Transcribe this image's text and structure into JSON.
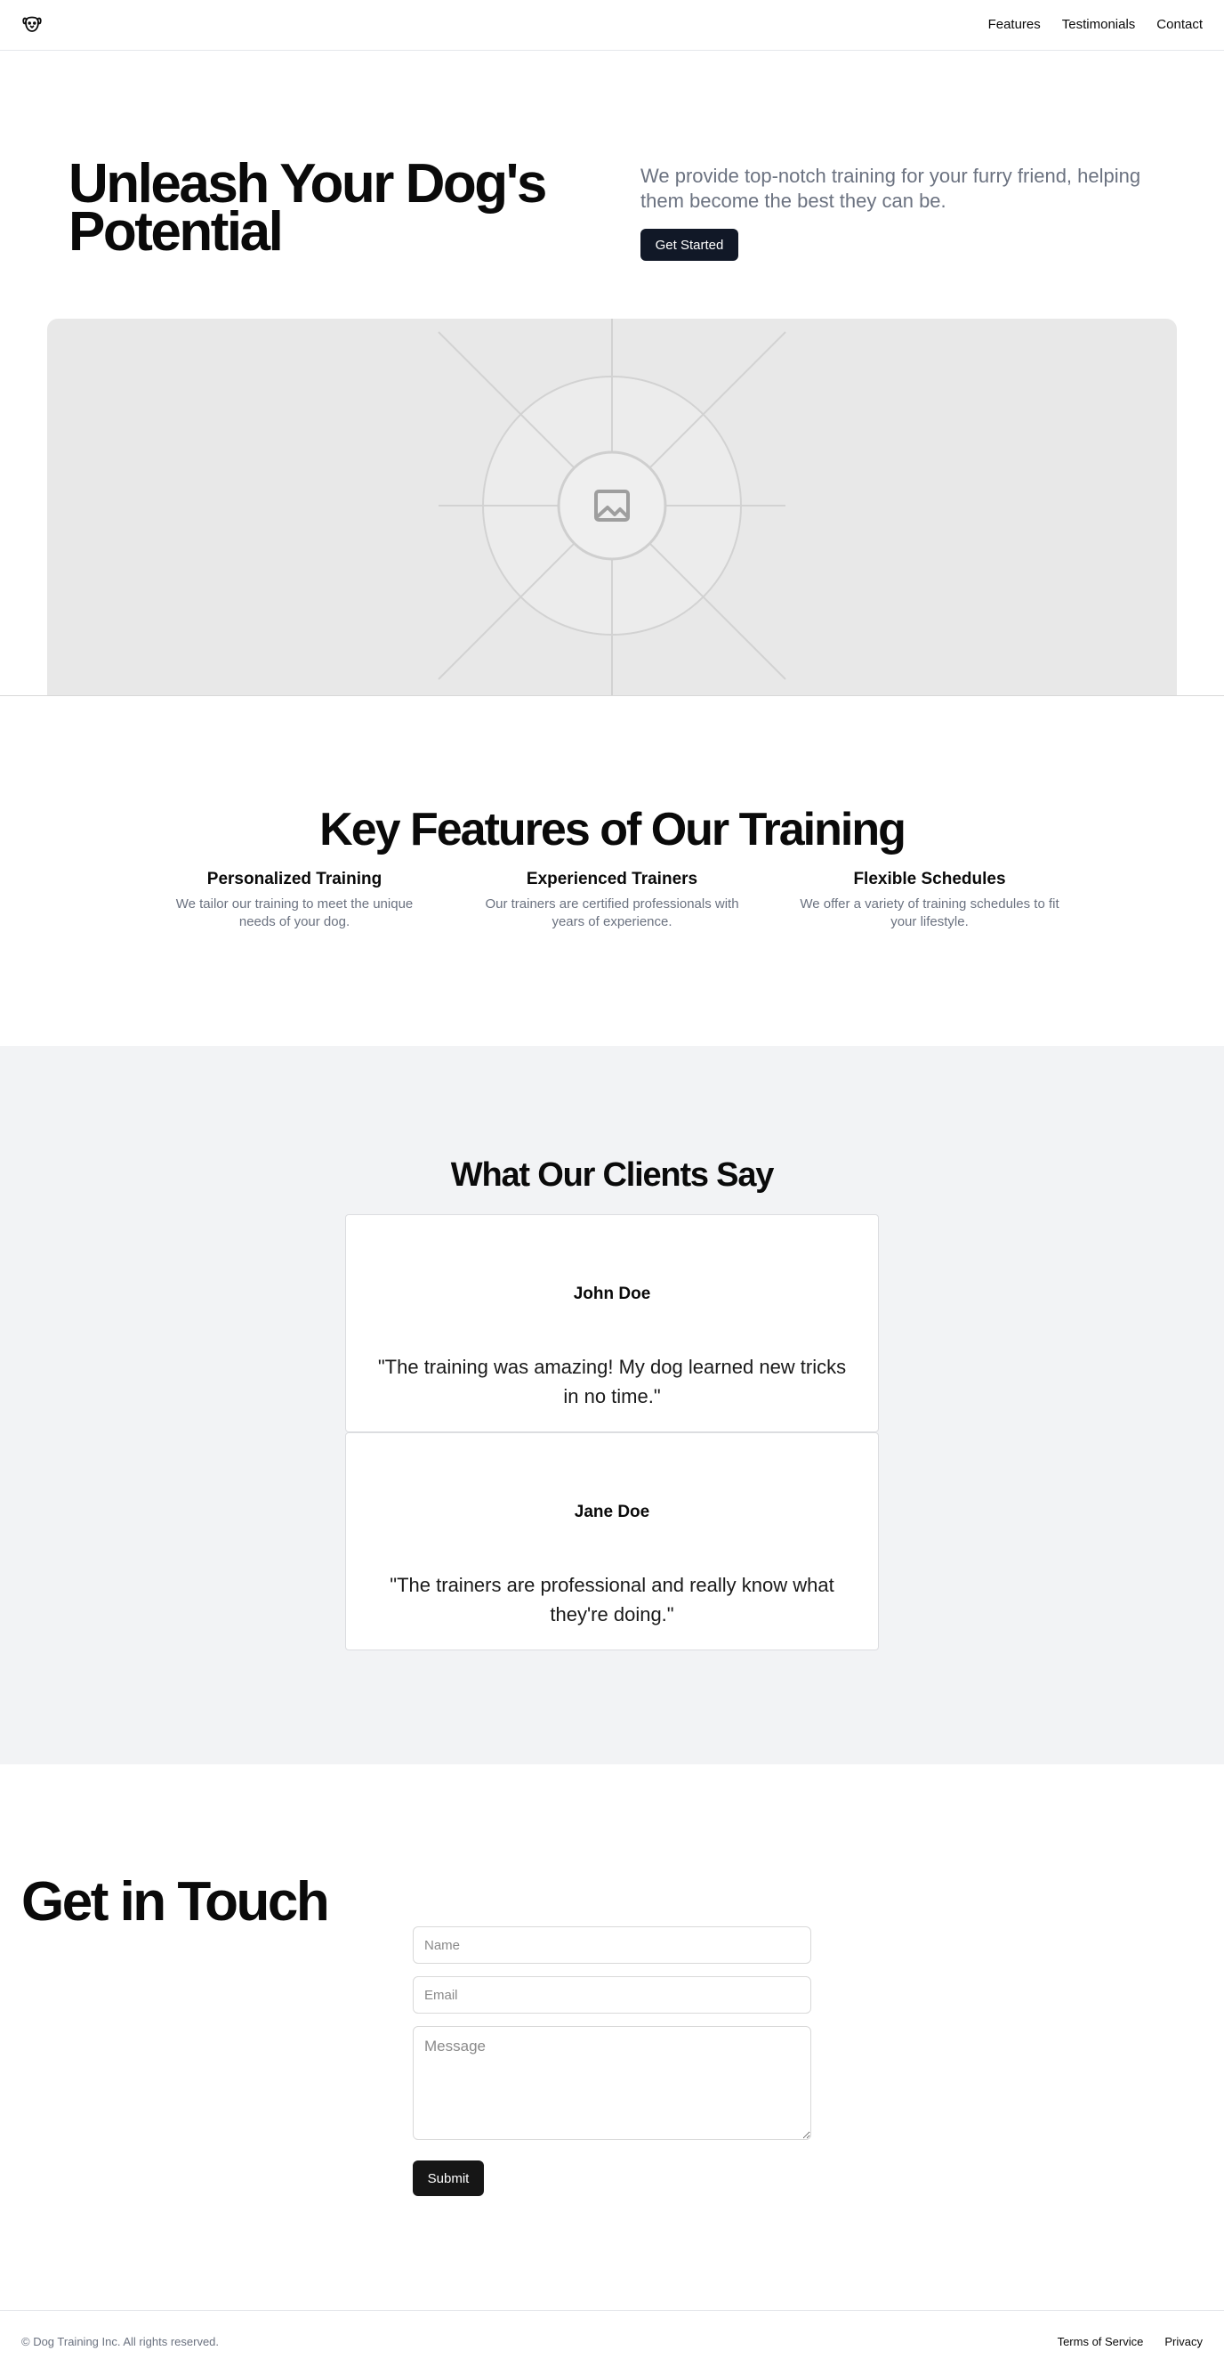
{
  "header": {
    "logo_icon": "dog-icon",
    "nav": [
      "Features",
      "Testimonials",
      "Contact"
    ]
  },
  "hero": {
    "title": "Unleash Your Dog's Potential",
    "description": "We provide top-notch training for your furry friend, helping them become the best they can be.",
    "cta_label": "Get Started",
    "image_icon": "image-placeholder-icon"
  },
  "features": {
    "title": "Key Features of Our Training",
    "items": [
      {
        "title": "Personalized Training",
        "description": "We tailor our training to meet the unique needs of your dog."
      },
      {
        "title": "Experienced Trainers",
        "description": "Our trainers are certified professionals with years of experience."
      },
      {
        "title": "Flexible Schedules",
        "description": "We offer a variety of training schedules to fit your lifestyle."
      }
    ]
  },
  "testimonials": {
    "title": "What Our Clients Say",
    "items": [
      {
        "name": "John Doe",
        "quote": "\"The training was amazing! My dog learned new tricks in no time.\""
      },
      {
        "name": "Jane Doe",
        "quote": "\"The trainers are professional and really know what they're doing.\""
      }
    ]
  },
  "contact": {
    "title": "Get in Touch",
    "name_placeholder": "Name",
    "email_placeholder": "Email",
    "message_placeholder": "Message",
    "submit_label": "Submit"
  },
  "footer": {
    "copyright": "© Dog Training Inc. All rights reserved.",
    "links": [
      "Terms of Service",
      "Privacy"
    ]
  },
  "colors": {
    "primary_button": "#111827",
    "muted_text": "#6b7280",
    "testimonials_bg": "#f2f3f5"
  }
}
